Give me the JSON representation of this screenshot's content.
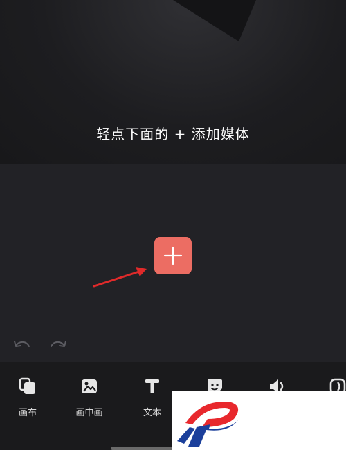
{
  "preview": {
    "hint": "轻点下面的 + 添加媒体"
  },
  "timeline": {
    "add_icon": "plus-icon",
    "undo_icon": "undo-icon",
    "redo_icon": "redo-icon"
  },
  "toolbar": {
    "items": [
      {
        "label": "画布",
        "icon": "canvas-icon"
      },
      {
        "label": "画中画",
        "icon": "picture-in-picture-icon"
      },
      {
        "label": "文本",
        "icon": "text-icon"
      },
      {
        "label": "",
        "icon": "sticker-icon"
      },
      {
        "label": "",
        "icon": "audio-icon"
      },
      {
        "label": "",
        "icon": "effects-icon"
      }
    ]
  },
  "colors": {
    "accent": "#ec6d63",
    "annotation_arrow": "#e02a2a",
    "logo_red": "#e8282d",
    "logo_blue": "#1b3f9b"
  }
}
